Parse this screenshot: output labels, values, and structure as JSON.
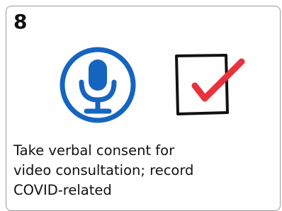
{
  "card": {
    "step_number": "8",
    "caption_lines": [
      "Take verbal consent for",
      "video consultation; record",
      "COVID-related"
    ]
  },
  "icons": {
    "primary": "microphone-icon",
    "secondary": "checked-checkbox-icon"
  },
  "colors": {
    "mic_blue": "#1565c0",
    "check_red": "#e8323c",
    "box_stroke": "#111111",
    "card_border": "#9a9a9a"
  }
}
